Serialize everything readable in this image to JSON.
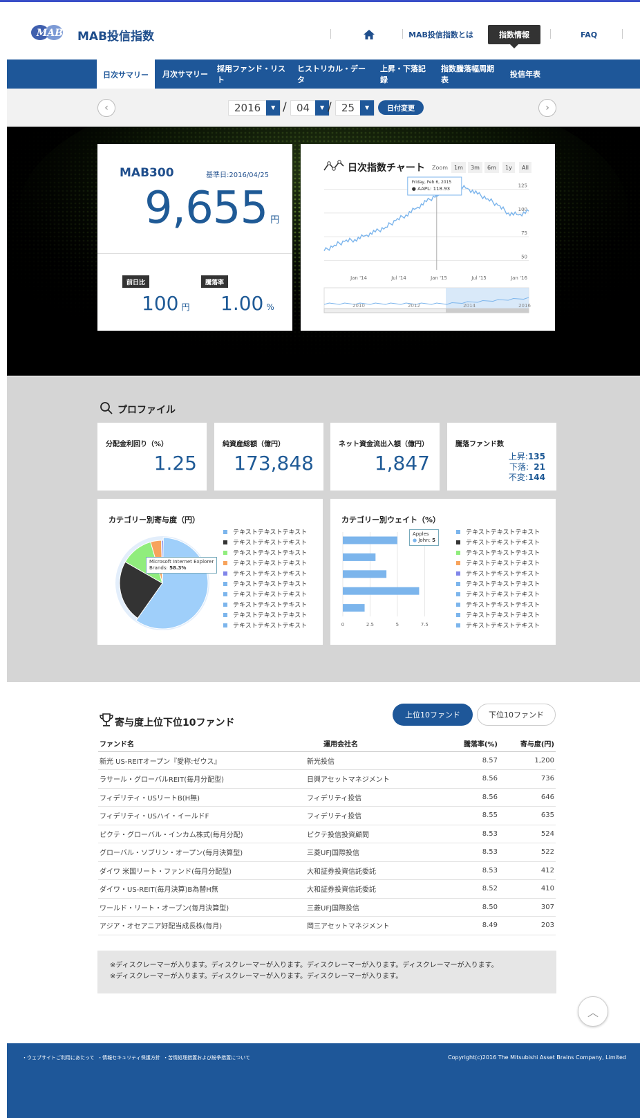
{
  "header": {
    "logo_text": "MAB",
    "site_title": "MAB投信指数",
    "nav": [
      "MAB投信指数とは",
      "指数情報",
      "FAQ"
    ]
  },
  "subnav": [
    "日次サマリー",
    "月次サマリー",
    "採用ファンド・リスト",
    "ヒストリカル・データ",
    "上昇・下落記録",
    "指数騰落幅周期表",
    "投信年表"
  ],
  "date": {
    "year": "2016",
    "month": "04",
    "day": "25",
    "sep": "/",
    "button": "日付変更"
  },
  "summary": {
    "name": "MAB300",
    "base_date": "基準日:2016/04/25",
    "value": "9,655",
    "value_unit": "円",
    "diff_label": "前日比",
    "diff_value": "100",
    "diff_unit": "円",
    "rate_label": "騰落率",
    "rate_value": "1.00",
    "rate_unit": "%"
  },
  "daily_chart": {
    "title": "日次指数チャート",
    "zoom_label": "Zoom",
    "zoom": [
      "1m",
      "3m",
      "6m",
      "1y",
      "All"
    ],
    "tooltip_date": "Friday, Feb 6, 2015",
    "tooltip_series": "AAPL:",
    "tooltip_value": "118.93",
    "y_ticks": [
      "125",
      "100",
      "75",
      "50"
    ],
    "x_ticks": [
      "Jan '14",
      "Jul '14",
      "Jan '15",
      "Jul '15",
      "Jan '16"
    ],
    "nav_ticks": [
      "2010",
      "2012",
      "2014",
      "2016"
    ]
  },
  "profile": {
    "title": "プロファイル",
    "stats": [
      {
        "label": "分配金利回り（%）",
        "value": "1.25"
      },
      {
        "label": "純資産総額（億円）",
        "value": "173,848"
      },
      {
        "label": "ネット資金流出入額（億円）",
        "value": "1,847"
      }
    ],
    "updown": {
      "label": "騰落ファンド数",
      "up_label": "上昇:",
      "up": "135",
      "down_label": "下落:",
      "down": "21",
      "flat_label": "不変:",
      "flat": "144"
    }
  },
  "pie_panel": {
    "title": "カテゴリー別寄与度（円）",
    "tooltip_name": "Microsoft Internet Explorer",
    "tooltip_label": "Brands:",
    "tooltip_value": "58.3%",
    "legend": [
      "テキストテキストテキスト",
      "テキストテキストテキスト",
      "テキストテキストテキスト",
      "テキストテキストテキスト",
      "テキストテキストテキスト",
      "テキストテキストテキスト",
      "テキストテキストテキスト",
      "テキストテキストテキスト",
      "テキストテキストテキスト",
      "テキストテキストテキスト"
    ],
    "legend_colors": [
      "#7cb5ec",
      "#333333",
      "#90ed7d",
      "#f7a35c",
      "#8085e9",
      "#7cb5ec",
      "#7cb5ec",
      "#7cb5ec",
      "#7cb5ec",
      "#7cb5ec"
    ]
  },
  "bar_panel": {
    "title": "カテゴリー別ウェイト（%）",
    "tooltip_cat": "Apples",
    "tooltip_series": "John:",
    "tooltip_value": "5",
    "x_ticks": [
      "0",
      "2.5",
      "5",
      "7.5"
    ],
    "legend": [
      "テキストテキストテキスト",
      "テキストテキストテキスト",
      "テキストテキストテキスト",
      "テキストテキストテキスト",
      "テキストテキストテキスト",
      "テキストテキストテキスト",
      "テキストテキストテキスト",
      "テキストテキストテキスト",
      "テキストテキストテキスト",
      "テキストテキストテキスト"
    ],
    "legend_colors": [
      "#7cb5ec",
      "#333333",
      "#90ed7d",
      "#f7a35c",
      "#8085e9",
      "#7cb5ec",
      "#7cb5ec",
      "#7cb5ec",
      "#7cb5ec",
      "#7cb5ec"
    ]
  },
  "chart_data": [
    {
      "type": "line",
      "title": "日次指数チャート",
      "series": [
        {
          "name": "AAPL",
          "values": [
            60,
            66,
            70,
            72,
            76,
            80,
            85,
            92,
            98,
            105,
            112,
            118.93,
            125,
            128,
            126,
            120,
            115,
            108,
            100,
            98,
            102
          ]
        }
      ],
      "ylim": [
        40,
        135
      ]
    },
    {
      "type": "pie",
      "values": [
        58.3,
        23,
        12,
        4,
        0.7
      ],
      "colors": [
        "#9fcffa",
        "#333333",
        "#90ed7d",
        "#f7a35c",
        "#8085e9"
      ]
    },
    {
      "type": "bar",
      "values": [
        5,
        3,
        4,
        7,
        2
      ],
      "xlim": [
        0,
        9
      ],
      "x_ticks": [
        0,
        2.5,
        5,
        7.5
      ]
    }
  ],
  "ranking": {
    "title": "寄与度上位下位10ファンド",
    "btn_top": "上位10ファンド",
    "btn_bottom": "下位10ファンド",
    "headers": [
      "ファンド名",
      "運用会社名",
      "騰落率(%)",
      "寄与度(円)"
    ],
    "rows": [
      [
        "新光 US-REITオープン『愛称:ゼウス』",
        "新光投信",
        "8.57",
        "1,200"
      ],
      [
        "ラサール・グローバルREIT(毎月分配型)",
        "日興アセットマネジメント",
        "8.56",
        "736"
      ],
      [
        "フィデリティ・USリートB(H無)",
        "フィデリティ投信",
        "8.56",
        "646"
      ],
      [
        "フィデリティ・USハイ・イールドF",
        "フィデリティ投信",
        "8.55",
        "635"
      ],
      [
        "ピクテ・グローバル・インカム株式(毎月分配)",
        "ピクテ投信投資顧問",
        "8.53",
        "524"
      ],
      [
        "グローバル・ソブリン・オープン(毎月決算型)",
        "三菱UFJ国際投信",
        "8.53",
        "522"
      ],
      [
        "ダイワ 米国リート・ファンド(毎月分配型)",
        "大和証券投資信託委託",
        "8.53",
        "412"
      ],
      [
        "ダイワ・US-REIT(毎月決算)B為替H無",
        "大和証券投資信託委託",
        "8.52",
        "410"
      ],
      [
        "ワールド・リート・オープン(毎月決算型)",
        "三菱UFJ国際投信",
        "8.50",
        "307"
      ],
      [
        "アジア・オセアニア好配当成長株(毎月)",
        "岡三アセットマネジメント",
        "8.49",
        "203"
      ]
    ]
  },
  "disclaimer": [
    "※ディスクレーマーが入ります。ディスクレーマーが入ります。ディスクレーマーが入ります。ディスクレーマーが入ります。",
    "※ディスクレーマーが入ります。ディスクレーマーが入ります。ディスクレーマーが入ります。"
  ],
  "footer": {
    "links": [
      "ウェブサイトご利用にあたって",
      "情報セキュリティ保護方針",
      "苦情処理措置および紛争措置について"
    ],
    "copyright": "Copyright(c)2016 The Mitsubishi Asset Brains Company, Limited"
  },
  "colors": {
    "brand": "#1e5799",
    "accent_text": "#1f5a96"
  }
}
